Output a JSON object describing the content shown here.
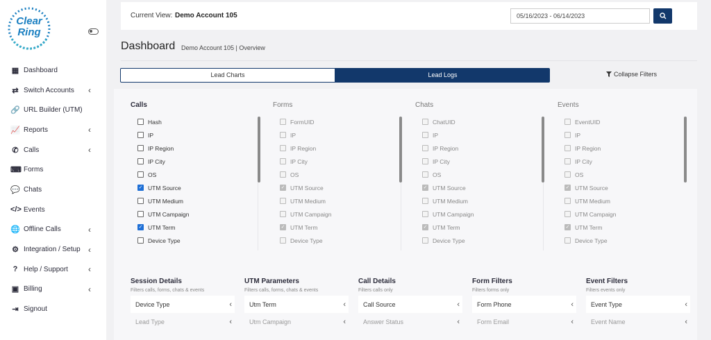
{
  "brand": {
    "logo_text_line1": "Clear",
    "logo_text_line2": "Ring",
    "accent": "#12386b",
    "logo_color": "#1a7fc1"
  },
  "sidebar": {
    "items": [
      {
        "label": "Dashboard",
        "icon": "bar-chart-icon",
        "glyph": "▦",
        "chevron": false
      },
      {
        "label": "Switch Accounts",
        "icon": "shuffle-icon",
        "glyph": "⇄",
        "chevron": true
      },
      {
        "label": "URL Builder (UTM)",
        "icon": "link-icon",
        "glyph": "🔗",
        "chevron": false
      },
      {
        "label": "Reports",
        "icon": "line-chart-icon",
        "glyph": "📈",
        "chevron": true
      },
      {
        "label": "Calls",
        "icon": "phone-icon",
        "glyph": "✆",
        "chevron": true
      },
      {
        "label": "Forms",
        "icon": "keyboard-icon",
        "glyph": "⌨",
        "chevron": false
      },
      {
        "label": "Chats",
        "icon": "comments-icon",
        "glyph": "💬",
        "chevron": false
      },
      {
        "label": "Events",
        "icon": "code-icon",
        "glyph": "</>",
        "chevron": false
      },
      {
        "label": "Offline Calls",
        "icon": "globe-icon",
        "glyph": "🌐",
        "chevron": true
      },
      {
        "label": "Integration / Setup",
        "icon": "gears-icon",
        "glyph": "⚙",
        "chevron": true
      },
      {
        "label": "Help / Support",
        "icon": "question-circle-icon",
        "glyph": "?",
        "chevron": true
      },
      {
        "label": "Billing",
        "icon": "wallet-icon",
        "glyph": "▣",
        "chevron": true
      },
      {
        "label": "Signout",
        "icon": "sign-out-icon",
        "glyph": "⇥",
        "chevron": false
      }
    ]
  },
  "topbar": {
    "current_view_label": "Current View:",
    "current_view_value": "Demo Account 105",
    "date_range": "05/16/2023 - 06/14/2023"
  },
  "header": {
    "title": "Dashboard",
    "breadcrumb": "Demo Account 105 |   Overview"
  },
  "tabs": {
    "lead_charts": "Lead Charts",
    "lead_logs": "Lead Logs",
    "collapse_filters": "Collapse Filters"
  },
  "columns": [
    {
      "title": "Calls",
      "disabled": false,
      "items": [
        {
          "label": "Hash",
          "checked": false
        },
        {
          "label": "IP",
          "checked": false
        },
        {
          "label": "IP Region",
          "checked": false
        },
        {
          "label": "IP City",
          "checked": false
        },
        {
          "label": "OS",
          "checked": false
        },
        {
          "label": "UTM Source",
          "checked": true
        },
        {
          "label": "UTM Medium",
          "checked": false
        },
        {
          "label": "UTM Campaign",
          "checked": false
        },
        {
          "label": "UTM Term",
          "checked": true
        },
        {
          "label": "Device Type",
          "checked": false
        }
      ]
    },
    {
      "title": "Forms",
      "disabled": true,
      "items": [
        {
          "label": "FormUID",
          "checked": false
        },
        {
          "label": "IP",
          "checked": false
        },
        {
          "label": "IP Region",
          "checked": false
        },
        {
          "label": "IP City",
          "checked": false
        },
        {
          "label": "OS",
          "checked": false
        },
        {
          "label": "UTM Source",
          "checked": true
        },
        {
          "label": "UTM Medium",
          "checked": false
        },
        {
          "label": "UTM Campaign",
          "checked": false
        },
        {
          "label": "UTM Term",
          "checked": true
        },
        {
          "label": "Device Type",
          "checked": false
        }
      ]
    },
    {
      "title": "Chats",
      "disabled": true,
      "items": [
        {
          "label": "ChatUID",
          "checked": false
        },
        {
          "label": "IP",
          "checked": false
        },
        {
          "label": "IP Region",
          "checked": false
        },
        {
          "label": "IP City",
          "checked": false
        },
        {
          "label": "OS",
          "checked": false
        },
        {
          "label": "UTM Source",
          "checked": true
        },
        {
          "label": "UTM Medium",
          "checked": false
        },
        {
          "label": "UTM Campaign",
          "checked": false
        },
        {
          "label": "UTM Term",
          "checked": true
        },
        {
          "label": "Device Type",
          "checked": false
        }
      ]
    },
    {
      "title": "Events",
      "disabled": true,
      "items": [
        {
          "label": "EventUID",
          "checked": false
        },
        {
          "label": "IP",
          "checked": false
        },
        {
          "label": "IP Region",
          "checked": false
        },
        {
          "label": "IP City",
          "checked": false
        },
        {
          "label": "OS",
          "checked": false
        },
        {
          "label": "UTM Source",
          "checked": true
        },
        {
          "label": "UTM Medium",
          "checked": false
        },
        {
          "label": "UTM Campaign",
          "checked": false
        },
        {
          "label": "UTM Term",
          "checked": true
        },
        {
          "label": "Device Type",
          "checked": false
        }
      ]
    }
  ],
  "filter_groups": [
    {
      "title": "Session Details",
      "subtitle": "Filters calls, forms, chats & events",
      "first": "Device Type",
      "second": "Lead Type"
    },
    {
      "title": "UTM Parameters",
      "subtitle": "Filters calls, forms, chats & events",
      "first": "Utm Term",
      "second": "Utm Campaign"
    },
    {
      "title": "Call Details",
      "subtitle": "Filters calls only",
      "first": "Call Source",
      "second": "Answer Status"
    },
    {
      "title": "Form Filters",
      "subtitle": "Filters forms only",
      "first": "Form Phone",
      "second": "Form Email"
    },
    {
      "title": "Event Filters",
      "subtitle": "Filters events only",
      "first": "Event Type",
      "second": "Event Name"
    }
  ]
}
